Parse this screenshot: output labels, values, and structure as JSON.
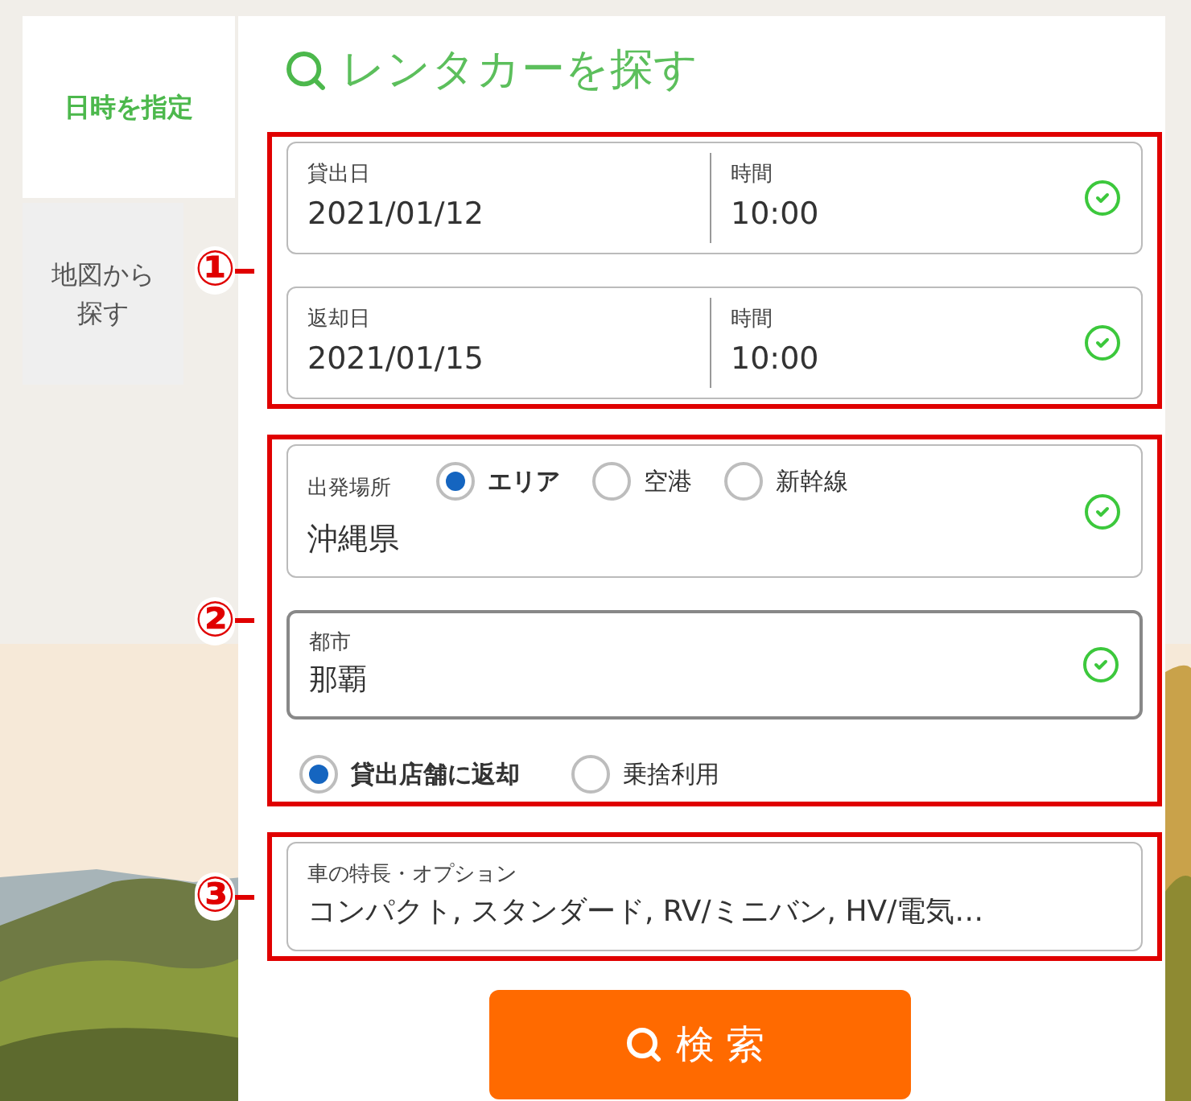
{
  "tabs": [
    {
      "label": "日時を指定",
      "selected": true
    },
    {
      "label": "地図から探す",
      "selected": false
    }
  ],
  "title": "レンタカーを探す",
  "sections": [
    {
      "marker": "①",
      "fields": [
        {
          "kind": "datetime",
          "label": "貸出日",
          "value": "2021/01/12",
          "time_label": "時間",
          "time_value": "10:00",
          "valid": true
        },
        {
          "kind": "datetime",
          "label": "返却日",
          "value": "2021/01/15",
          "time_label": "時間",
          "time_value": "10:00",
          "valid": true
        }
      ]
    },
    {
      "marker": "②",
      "fields": [
        {
          "kind": "place",
          "label": "出発場所",
          "options": [
            {
              "label": "エリア",
              "selected": true
            },
            {
              "label": "空港",
              "selected": false
            },
            {
              "label": "新幹線",
              "selected": false
            }
          ],
          "value": "沖縄県",
          "valid": true
        },
        {
          "kind": "text",
          "label": "都市",
          "value": "那覇",
          "valid": true,
          "focused": true
        },
        {
          "kind": "radios",
          "options": [
            {
              "label": "貸出店舗に返却",
              "selected": true
            },
            {
              "label": "乗捨利用",
              "selected": false
            }
          ]
        }
      ]
    },
    {
      "marker": "③",
      "fields": [
        {
          "kind": "text",
          "label": "車の特長・オプション",
          "value": "コンパクト, スタンダード, RV/ミニバン, HV/電気…",
          "valid": false,
          "focused": false
        }
      ]
    }
  ],
  "search_button": "検索"
}
